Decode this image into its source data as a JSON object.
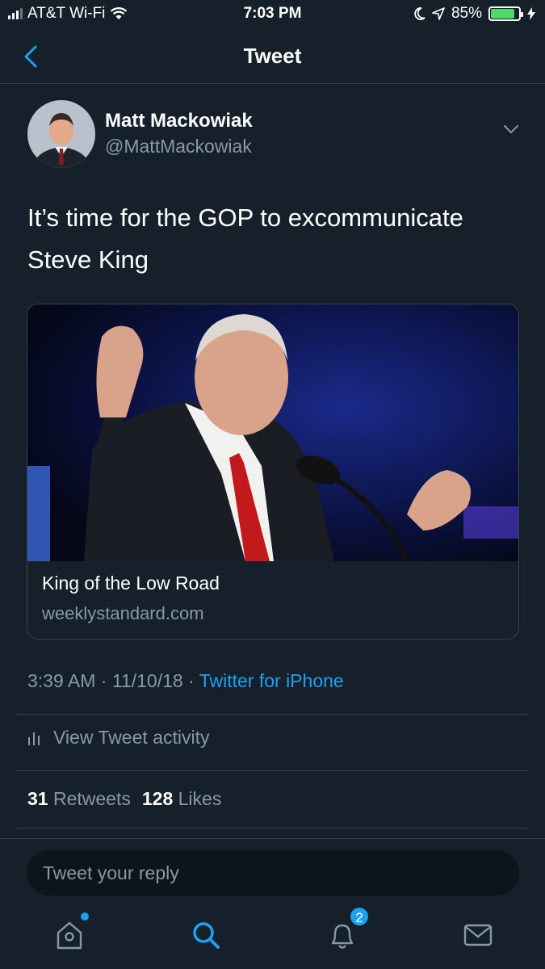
{
  "status_bar": {
    "carrier": "AT&T Wi-Fi",
    "time": "7:03 PM",
    "battery": "85%",
    "battery_level": 0.85
  },
  "header": {
    "title": "Tweet",
    "back_icon": "chevron-left-icon"
  },
  "tweet": {
    "author_name": "Matt Mackowiak",
    "author_handle": "@MattMackowiak",
    "text": "It’s time for the GOP to excommunicate Steve King",
    "card": {
      "title": "King of the Low Road",
      "domain": "weeklystandard.com"
    },
    "time": "3:39 AM",
    "date": "11/10/18",
    "separator": "·",
    "source": "Twitter for iPhone",
    "activity_label": "View Tweet activity",
    "retweets_count": "31",
    "retweets_label": "Retweets",
    "likes_count": "128",
    "likes_label": "Likes"
  },
  "reply": {
    "placeholder": "Tweet your reply"
  },
  "tabbar": {
    "tabs": [
      {
        "icon": "home-icon",
        "has_dot": true
      },
      {
        "icon": "search-icon",
        "active": true
      },
      {
        "icon": "notifications-icon",
        "badge": "2"
      },
      {
        "icon": "messages-icon"
      }
    ]
  },
  "colors": {
    "background": "#15202b",
    "accent": "#1da1f2",
    "secondary_text": "#8899a6",
    "divider": "#38444d"
  }
}
